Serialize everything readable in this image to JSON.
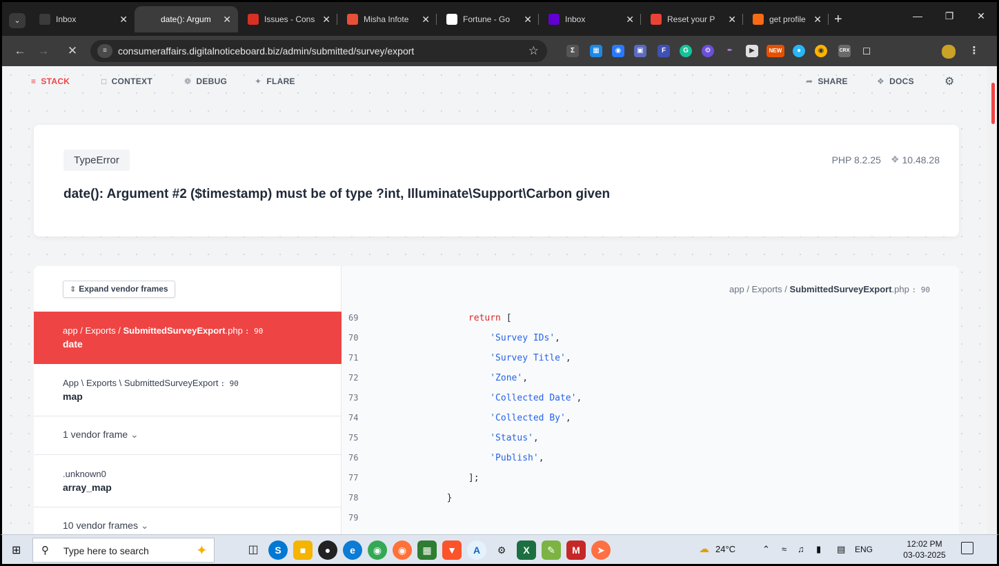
{
  "browser": {
    "tabs": [
      {
        "title": "Inbox",
        "icon": "inbox-icon",
        "color": "#3b3b3b",
        "active": false
      },
      {
        "title": "date(): Argum",
        "icon": "loading-icon",
        "color": "#3c3c3c",
        "active": true
      },
      {
        "title": "Issues - Cons",
        "icon": "issues-icon",
        "color": "#d93025",
        "active": false
      },
      {
        "title": "Misha Infote",
        "icon": "misha-icon",
        "color": "#e8503a",
        "active": false
      },
      {
        "title": "Fortune - Go",
        "icon": "google-icon",
        "color": "#ffffff",
        "active": false
      },
      {
        "title": "Inbox",
        "icon": "yahoo-icon",
        "color": "#6001d2",
        "active": false
      },
      {
        "title": "Reset your P",
        "icon": "gmail-icon",
        "color": "#ea4335",
        "active": false
      },
      {
        "title": "get profile -",
        "icon": "postman-icon",
        "color": "#f76b15",
        "active": false
      }
    ],
    "url": "consumeraffairs.digitalnoticeboard.biz/admin/submitted/survey/export"
  },
  "ignition": {
    "nav": {
      "stack": "STACK",
      "context": "CONTEXT",
      "debug": "DEBUG",
      "flare": "FLARE",
      "share": "SHARE",
      "docs": "DOCS"
    },
    "exception_class": "TypeError",
    "php_version": "PHP 8.2.25",
    "laravel_version": "10.48.28",
    "message": "date(): Argument #2 ($timestamp) must be of type ?int, Illuminate\\Support\\Carbon given",
    "expand_vendor_label": "Expand vendor frames",
    "frames": [
      {
        "path_prefix": "app / Exports / ",
        "file": "SubmittedSurveyExport",
        "ext": ".php",
        "line": ": 90",
        "func": "date"
      },
      {
        "path_prefix": "App \\ Exports \\ SubmittedSurveyExport",
        "file": "",
        "ext": "",
        "line": ": 90",
        "func": "map"
      },
      {
        "vendor": "1 vendor frame"
      },
      {
        "path_prefix": ".unknown0",
        "file": "",
        "ext": "",
        "line": "",
        "func": "array_map"
      },
      {
        "vendor": "10 vendor frames"
      }
    ],
    "code_file": {
      "prefix": "app / Exports / ",
      "file": "SubmittedSurveyExport",
      "ext": ".php",
      "line": ": 90"
    },
    "code_lines": [
      {
        "num": "69",
        "indent": "            ",
        "kw": "return",
        "rest": " ["
      },
      {
        "num": "70",
        "indent": "                ",
        "str": "'Survey IDs'",
        "rest": ","
      },
      {
        "num": "71",
        "indent": "                ",
        "str": "'Survey Title'",
        "rest": ","
      },
      {
        "num": "72",
        "indent": "                ",
        "str": "'Zone'",
        "rest": ","
      },
      {
        "num": "73",
        "indent": "                ",
        "str": "'Collected Date'",
        "rest": ","
      },
      {
        "num": "74",
        "indent": "                ",
        "str": "'Collected By'",
        "rest": ","
      },
      {
        "num": "75",
        "indent": "                ",
        "str": "'Status'",
        "rest": ","
      },
      {
        "num": "76",
        "indent": "                ",
        "str": "'Publish'",
        "rest": ","
      },
      {
        "num": "77",
        "indent": "            ",
        "rest": "];"
      },
      {
        "num": "78",
        "indent": "        ",
        "rest": "}"
      },
      {
        "num": "79",
        "indent": "",
        "rest": ""
      }
    ]
  },
  "taskbar": {
    "search_placeholder": "Type here to search",
    "weather": "24°C",
    "language": "ENG",
    "time": "12:02 PM",
    "date": "03-03-2025"
  },
  "colors": {
    "accent": "#ef4444",
    "keyword": "#dc2626",
    "string": "#2563eb"
  }
}
